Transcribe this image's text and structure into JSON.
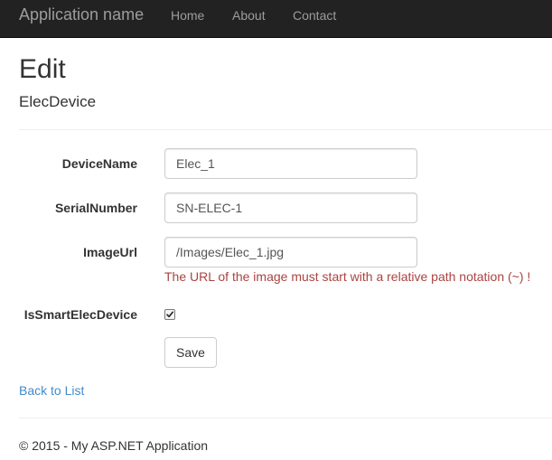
{
  "navbar": {
    "brand": "Application name",
    "links": [
      "Home",
      "About",
      "Contact"
    ]
  },
  "page": {
    "title": "Edit",
    "subtitle": "ElecDevice"
  },
  "form": {
    "device_name": {
      "label": "DeviceName",
      "value": "Elec_1"
    },
    "serial_number": {
      "label": "SerialNumber",
      "value": "SN-ELEC-1"
    },
    "image_url": {
      "label": "ImageUrl",
      "value": "/Images/Elec_1.jpg",
      "error": "The URL of the image must start with a relative path notation (~) !"
    },
    "is_smart": {
      "label": "IsSmartElecDevice",
      "checked": true
    },
    "save_label": "Save"
  },
  "back_link": "Back to List",
  "footer": "© 2015 - My ASP.NET Application",
  "colors": {
    "navbar_bg": "#222222",
    "nav_text": "#9d9d9d",
    "error": "#a94442",
    "link": "#428bca"
  }
}
